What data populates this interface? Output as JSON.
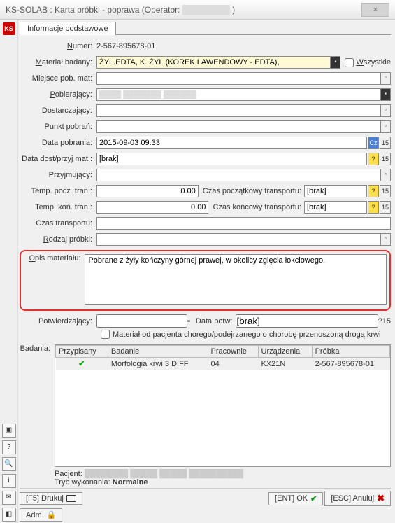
{
  "window": {
    "title_prefix": "KS-SOLAB :",
    "title_main": "Karta próbki - poprawa (Operator:",
    "title_suffix": ")",
    "close": "×"
  },
  "tab": {
    "info": "Informacje podstawowe"
  },
  "labels": {
    "numer": "Numer:",
    "material": "Materiał badany:",
    "wszystkie": "Wszystkie",
    "miejsce": "Miejsce pob. mat:",
    "pobierajacy": "Pobierający:",
    "dostarczajacy": "Dostarczający:",
    "punkt": "Punkt pobrań:",
    "data_pob": "Data pobrania:",
    "data_dost": "Data dost/przyj mat.:",
    "przyjmujacy": "Przyjmujący:",
    "temp_pocz": "Temp. pocz. tran.:",
    "czas_pocz": "Czas początkowy transportu:",
    "temp_kon": "Temp. koń. tran.:",
    "czas_kon": "Czas końcowy transportu:",
    "czas_trans": "Czas transportu:",
    "rodzaj": "Rodzaj próbki:",
    "opis": "Opis materiału:",
    "potwierdzajacy": "Potwierdzający:",
    "data_potw": "Data potw:",
    "mat_chory": "Materiał od pacjenta chorego/podejrzanego o chorobę przenoszoną drogą krwi",
    "badania": "Badania:",
    "pacjent": "Pacjent:",
    "tryb": "Tryb wykonania:"
  },
  "values": {
    "numer": "2-567-895678-01",
    "material": "ŻYL.EDTA, K. ŻYL.(KOREK LAWENDOWY - EDTA),",
    "data_pob": "2015-09-03 09:33",
    "brak": "[brak]",
    "temp_pocz": "0.00",
    "temp_kon": "0.00",
    "opis": "Pobrane z żyły kończyny górnej prawej, w okolicy zgięcia łokciowego.",
    "tryb_val": "Normalne"
  },
  "table": {
    "headers": [
      "Przypisany",
      "Badanie",
      "Pracownie",
      "Urządzenia",
      "Próbka"
    ],
    "row": {
      "check": "✔",
      "badanie": "Morfologia krwi 3 DIFF",
      "pracownie": "04",
      "urzadzenia": "KX21N",
      "probka": "2-567-895678-01"
    }
  },
  "buttons": {
    "drukuj": "[F5] Drukuj",
    "adm": "Adm.",
    "ok": "[ENT] OK",
    "anuluj": "[ESC] Anuluj"
  },
  "icons": {
    "cal": "15",
    "q": "?",
    "lock": "🔒",
    "info": "i"
  }
}
